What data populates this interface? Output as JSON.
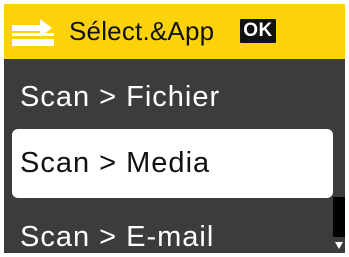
{
  "header": {
    "title": "Sélect.&App",
    "ok_label": "OK",
    "icon": "scan-to-icon"
  },
  "menu": {
    "items": [
      {
        "label": "Scan > Fichier",
        "selected": false
      },
      {
        "label": "Scan > Media",
        "selected": true
      },
      {
        "label": "Scan > E-mail",
        "selected": false
      }
    ]
  },
  "colors": {
    "header_background": "#fcd20a",
    "screen_background": "#3c3c3c",
    "selected_background": "#ffffff"
  }
}
